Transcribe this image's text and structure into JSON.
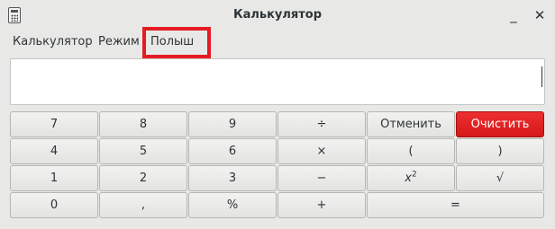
{
  "window": {
    "title": "Калькулятор",
    "minimize_glyph": "_",
    "close_glyph": "✕"
  },
  "menu": {
    "items": [
      "Калькулятор",
      "Режим",
      "Полыш"
    ]
  },
  "display": {
    "value": ""
  },
  "keys": {
    "k7": "7",
    "k8": "8",
    "k9": "9",
    "div": "÷",
    "cancel": "Отменить",
    "clear": "Очистить",
    "k4": "4",
    "k5": "5",
    "k6": "6",
    "mul": "×",
    "lparen": "(",
    "rparen": ")",
    "k1": "1",
    "k2": "2",
    "k3": "3",
    "minus": "−",
    "square_base": "x",
    "square_exp": "2",
    "sqrt": "√",
    "k0": "0",
    "comma": ",",
    "percent": "%",
    "plus": "+",
    "equals": "="
  },
  "colors": {
    "clear_button": "#e41b23",
    "highlight_frame": "#e41b23",
    "window_bg": "#e8e8e7"
  }
}
